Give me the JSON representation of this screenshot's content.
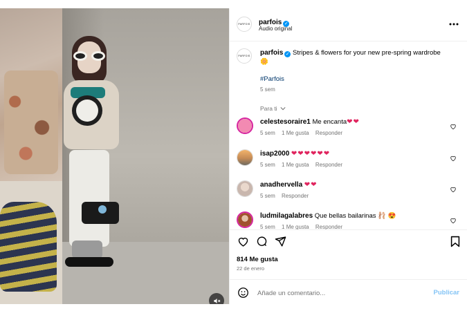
{
  "post": {
    "author": "parfois",
    "subtitle": "Audio original",
    "logo_text": "PARFOIS",
    "caption_text": "Stripes & flowers for your new pre-spring wardrobe 🌼",
    "hashtag": "#Parfois",
    "caption_time": "5 sem",
    "filter_label": "Para ti",
    "likes": "814 Me gusta",
    "date": "22 de enero"
  },
  "comments": [
    {
      "user": "celestesoraire1",
      "text": "Me encanta",
      "emojis": "❤❤",
      "time": "5 sem",
      "likes": "1 Me gusta",
      "reply": "Responder",
      "avatar_color": "#f28ab2"
    },
    {
      "user": "isap2000",
      "text": "",
      "emojis": "❤❤❤❤❤❤",
      "time": "5 sem",
      "likes": "1 Me gusta",
      "reply": "Responder",
      "avatar_color": "#c58b55"
    },
    {
      "user": "anadhervella",
      "text": "",
      "emojis": "❤❤",
      "time": "5 sem",
      "likes": "",
      "reply": "Responder",
      "avatar_color": "#c9b7ae"
    },
    {
      "user": "ludmilagalabres",
      "text": "Que bellas bailarinas",
      "emojis": "🩰 😍",
      "time": "5 sem",
      "likes": "1 Me gusta",
      "reply": "Responder",
      "avatar_color": "#a0522d"
    }
  ],
  "composer": {
    "placeholder": "Añade un comentario...",
    "publish": "Publicar"
  },
  "icons": {
    "more": "more-options-icon",
    "like": "heart-icon",
    "comment": "comment-icon",
    "share": "share-icon",
    "save": "bookmark-icon",
    "emoji": "emoji-icon",
    "mute": "speaker-muted-icon"
  },
  "colors": {
    "verified": "#0095f6",
    "publish": "#84c4f5",
    "heart": "#e0245e"
  }
}
